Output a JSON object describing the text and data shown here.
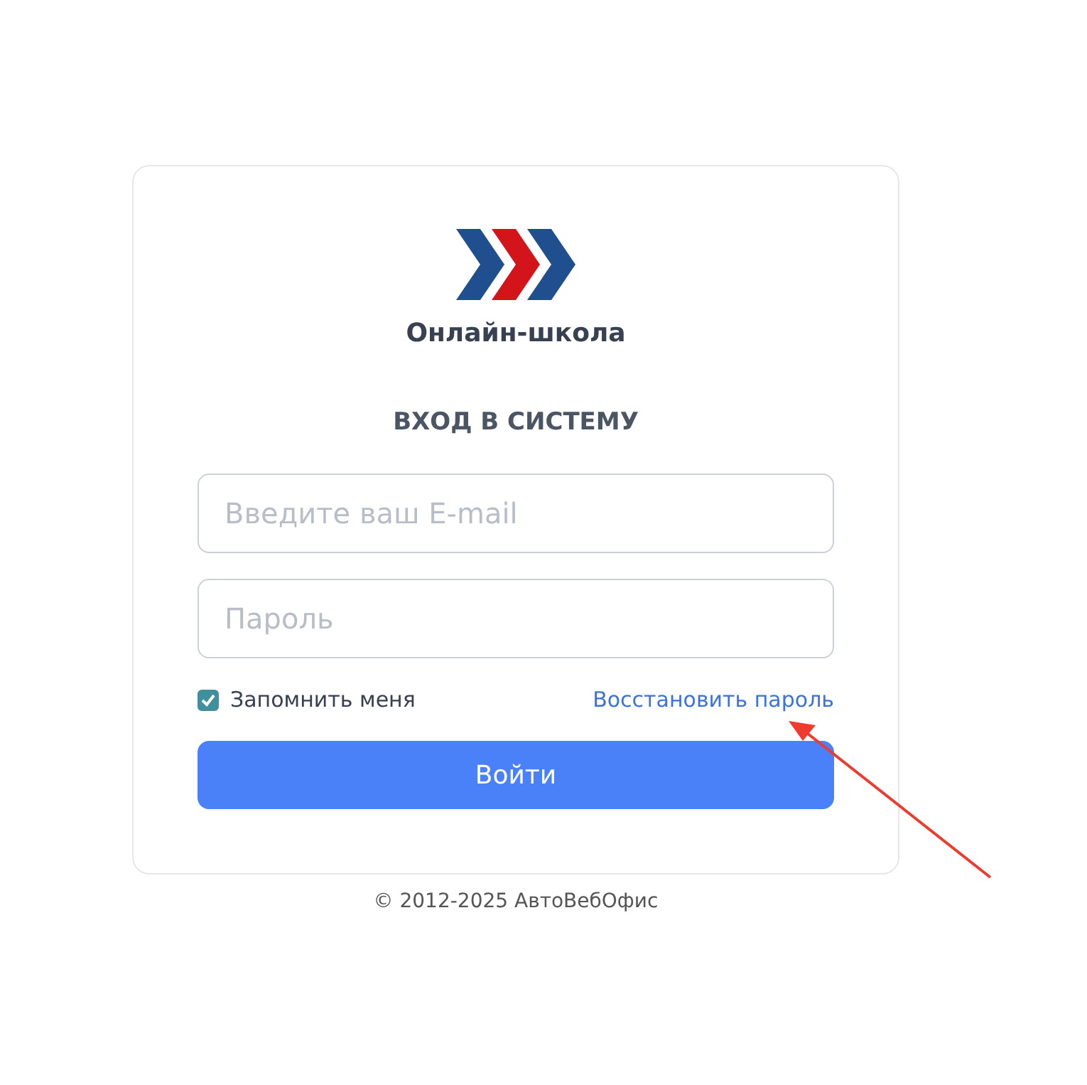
{
  "brand": {
    "name": "Онлайн-школа"
  },
  "heading": "ВХОД В СИСТЕМУ",
  "email_field": {
    "placeholder": "Введите ваш E-mail"
  },
  "password_field": {
    "placeholder": "Пароль"
  },
  "remember": {
    "label": "Запомнить меня",
    "checked": true
  },
  "recover_link": "Восстановить пароль",
  "submit_button": "Войти",
  "footer": "© 2012-2025 АвтоВебОфис"
}
